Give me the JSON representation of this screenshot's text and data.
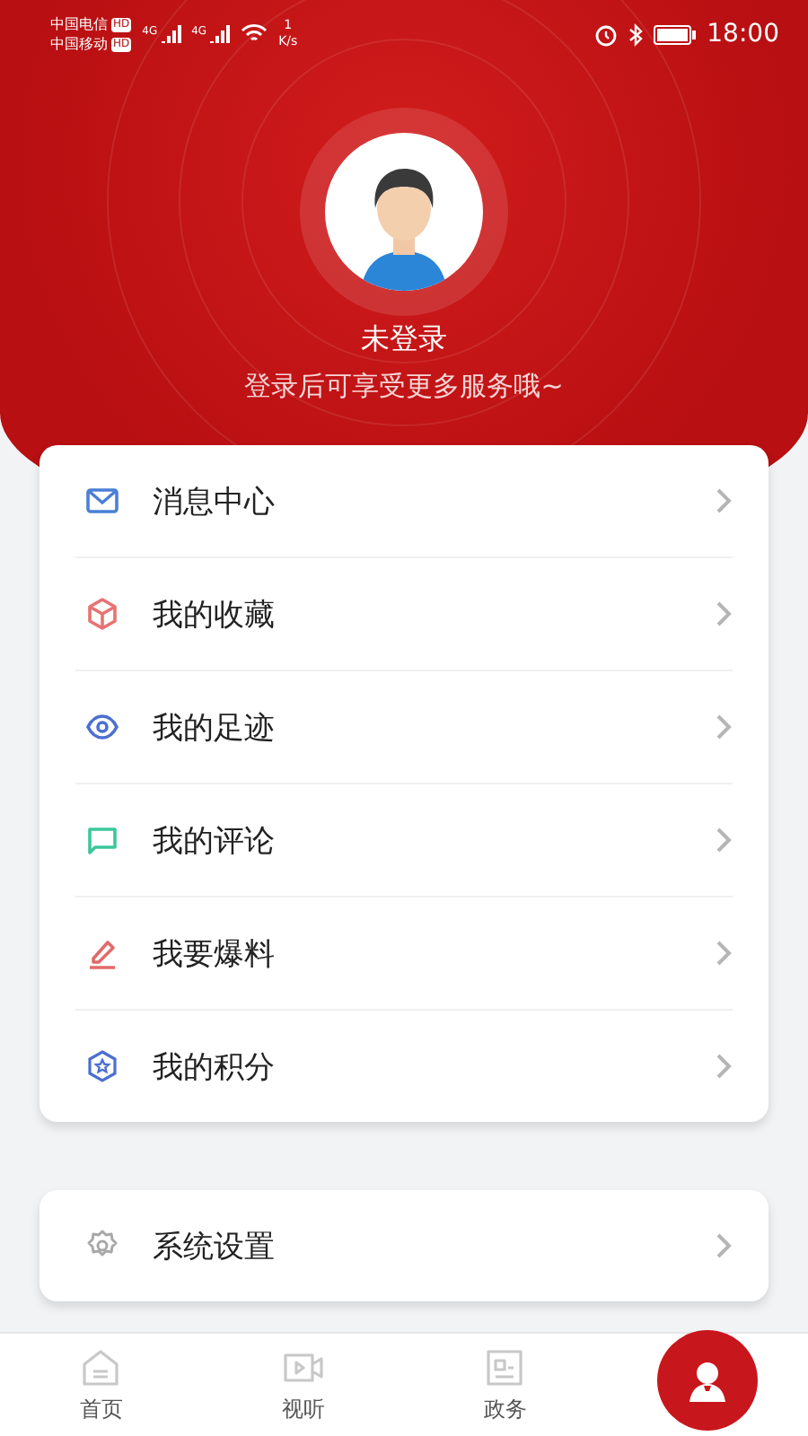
{
  "status_bar": {
    "carriers": [
      {
        "name": "中国电信",
        "badge": "HD"
      },
      {
        "name": "中国移动",
        "badge": "HD"
      }
    ],
    "networks": [
      "4G",
      "4G"
    ],
    "speed_value": "1",
    "speed_unit": "K/s",
    "time": "18:00"
  },
  "profile": {
    "name": "未登录",
    "hint": "登录后可享受更多服务哦~"
  },
  "menu": [
    {
      "kind": "mail",
      "label": "消息中心",
      "color": "#4a7fd6"
    },
    {
      "kind": "box",
      "label": "我的收藏",
      "color": "#e87272"
    },
    {
      "kind": "eye",
      "label": "我的足迹",
      "color": "#4a6fd0"
    },
    {
      "kind": "chat",
      "label": "我的评论",
      "color": "#3cc79a"
    },
    {
      "kind": "pencil",
      "label": "我要爆料",
      "color": "#e26a6a"
    },
    {
      "kind": "badge",
      "label": "我的积分",
      "color": "#4a6fd0"
    }
  ],
  "settings": [
    {
      "kind": "gear",
      "label": "系统设置",
      "color": "#a8a8a8"
    }
  ],
  "nav": [
    {
      "kind": "home",
      "label": "首页",
      "selected": false
    },
    {
      "kind": "video",
      "label": "视听",
      "selected": false
    },
    {
      "kind": "gov",
      "label": "政务",
      "selected": false
    },
    {
      "kind": "me",
      "selected": true
    }
  ]
}
